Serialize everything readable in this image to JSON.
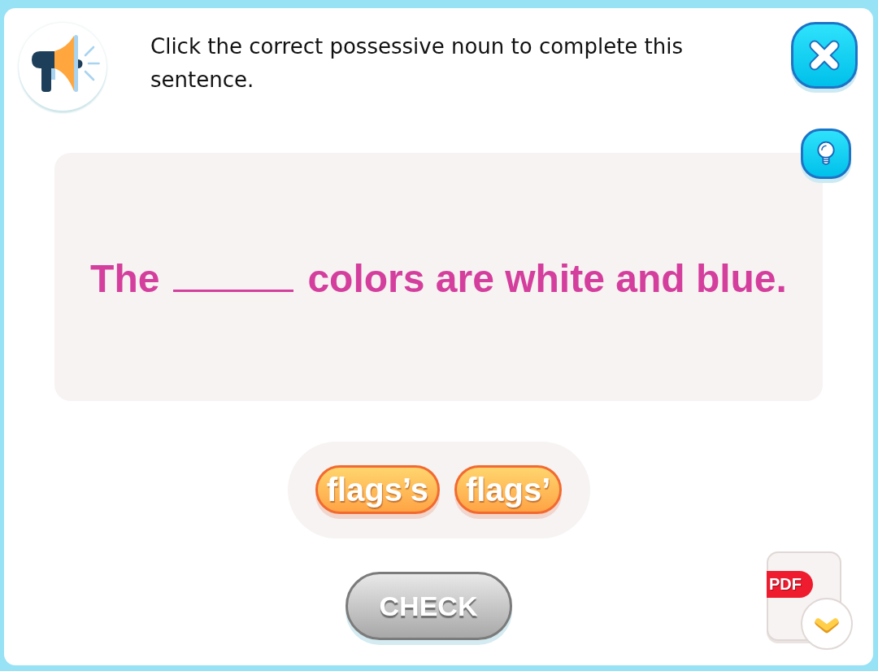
{
  "instruction": "Click the correct possessive noun to complete this sentence.",
  "sentence": {
    "before": "The",
    "after": "colors are white and blue."
  },
  "choices": [
    {
      "label": "flags’s",
      "selected": false
    },
    {
      "label": "flags’",
      "selected": false
    }
  ],
  "check_button": {
    "label": "CHECK",
    "disabled": true
  },
  "download": {
    "label": "PDF"
  }
}
